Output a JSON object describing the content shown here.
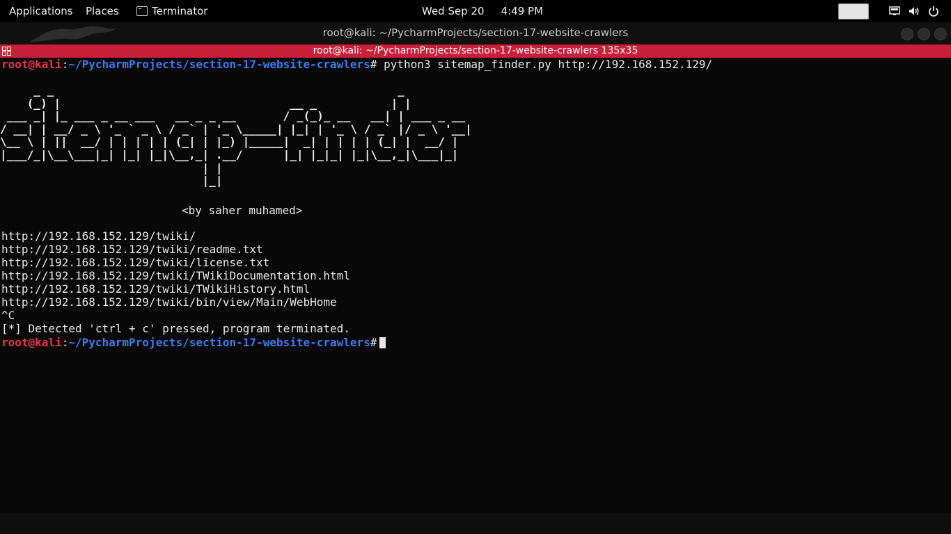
{
  "topbar": {
    "applications": "Applications",
    "places": "Places",
    "active_app": "Terminator",
    "date": "Wed Sep 20",
    "time": "4:49 PM"
  },
  "window": {
    "title": "root@kali: ~/PycharmProjects/section-17-website-crawlers",
    "terminal_title": "root@kali: ~/PycharmProjects/section-17-website-crawlers 135x35"
  },
  "colors": {
    "prompt_user": "#ee3347",
    "prompt_path": "#3d7bf0",
    "terminal_titlebar": "#c8203a"
  },
  "terminal": {
    "prompt_user": "root@kali",
    "prompt_colon": ":",
    "prompt_path": "~/PycharmProjects/section-17-website-crawlers",
    "prompt_hash": "#",
    "command": " python3 sitemap_finder.py http://192.168.152.129/",
    "banner": "     _ _                                                   _            \n    (_) |                                  __ _           | |           \n ___ _| |_ ___ _ __ ___   __ _ _ __       / _(_)_ __   __| | ___ _ __  \n/ __| | __/ _ \\ '_ ` _ \\ / _` | '_ \\_____| |_| | '_ \\ / _` |/ _ \\ '__| \n\\__ \\ | ||  __/ | | | | | (_| | |_) |_____|  _| | | | | (_| |  __/ |    \n|___/_|\\__\\___|_| |_| |_|\\__,_| .__/      |_| |_|_| |_|\\__,_|\\___|_|    \n                              | |                                       \n                              |_|                                       ",
    "author": "<by saher muhamed>",
    "output": [
      "http://192.168.152.129/twiki/",
      "http://192.168.152.129/twiki/readme.txt",
      "http://192.168.152.129/twiki/license.txt",
      "http://192.168.152.129/twiki/TWikiDocumentation.html",
      "http://192.168.152.129/twiki/TWikiHistory.html",
      "http://192.168.152.129/twiki/bin/view/Main/WebHome",
      "^C",
      "[*] Detected 'ctrl + c' pressed, program terminated."
    ]
  }
}
